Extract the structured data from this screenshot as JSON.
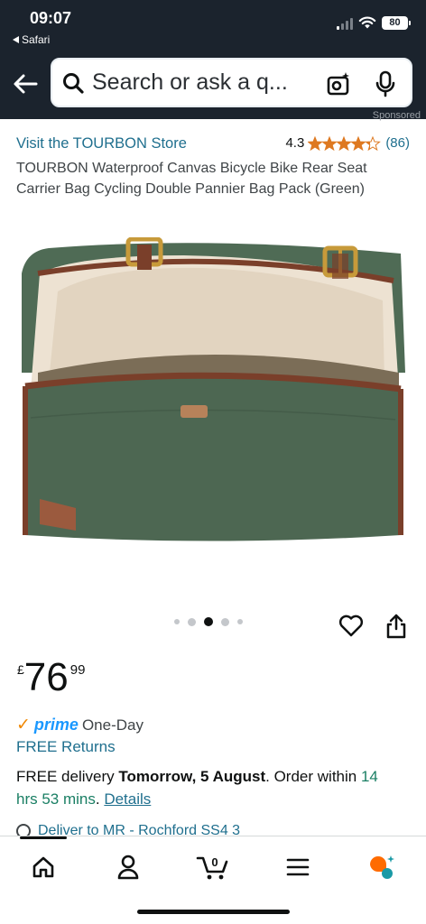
{
  "status_bar": {
    "time": "09:07",
    "back_app": "Safari",
    "battery": "80"
  },
  "search": {
    "placeholder": "Search or ask a q..."
  },
  "product": {
    "sponsored_label": "Sponsored",
    "store_link": "Visit the TOURBON Store",
    "rating": "4.3",
    "rating_count": "(86)",
    "title": "TOURBON Waterproof Canvas Bicycle Bike Rear Seat Carrier Bag Cycling Double Pannier Bag Pack (Green)",
    "image_count": 5,
    "selected_image_index": 2
  },
  "price": {
    "currency": "£",
    "whole": "76",
    "fraction": "99"
  },
  "delivery": {
    "prime_label": "prime",
    "prime_speed": "One-Day",
    "free_returns": "FREE Returns",
    "line_prefix": "FREE delivery ",
    "date": "Tomorrow, 5 August",
    "order_text": ". Order within ",
    "countdown": "14 hrs 53 mins",
    "period": ". ",
    "details_link": "Details",
    "deliver_to": "Deliver to MR - Rochford SS4 3"
  },
  "colors": {
    "top_bar": "#1b232d",
    "link": "#1f6f8e",
    "star": "#de7921",
    "prime_blue": "#1a98ff",
    "prime_check": "#f08804",
    "countdown_green": "#1a7f64",
    "bag_green": "#4f6b55",
    "bag_trim": "#7a3f2a"
  },
  "bottom_nav": {
    "items": [
      "home-icon",
      "account-icon",
      "cart-icon",
      "menu-icon",
      "rufus-ai-icon"
    ],
    "cart_count": "0"
  }
}
